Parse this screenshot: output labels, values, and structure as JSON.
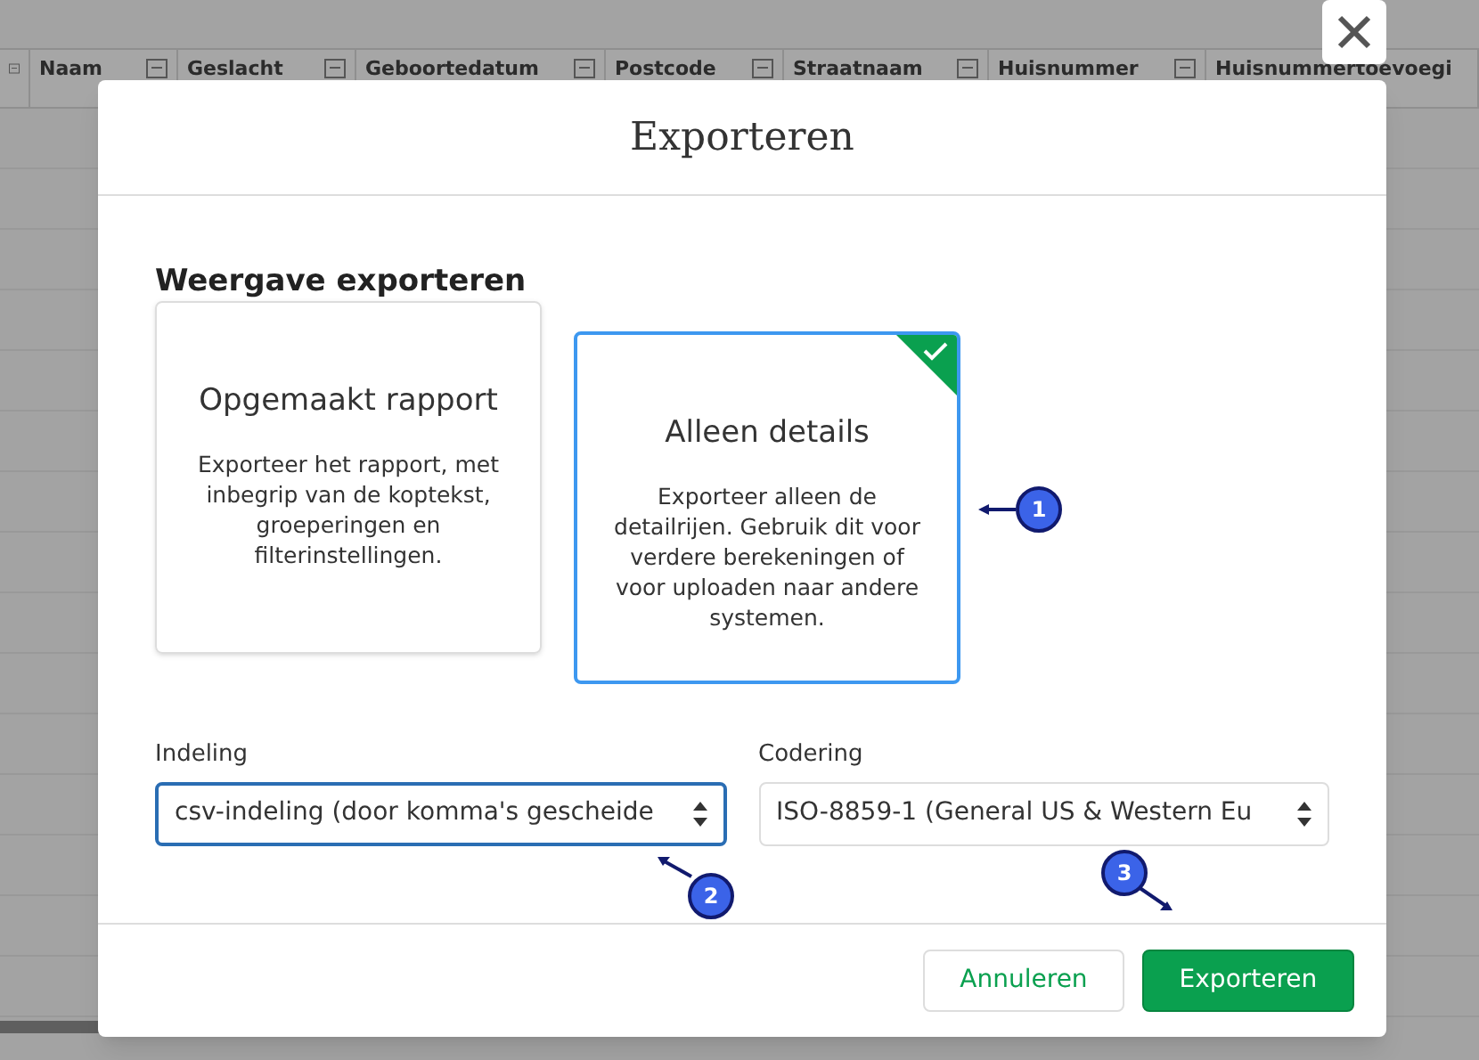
{
  "background_table": {
    "columns": [
      "Naam",
      "Geslacht",
      "Geboortedatum",
      "Postcode",
      "Straatnaam",
      "Huisnummer",
      "Huisnummertoevoegi"
    ]
  },
  "dialog": {
    "title": "Exporteren",
    "section_title": "Weergave exporteren",
    "options": [
      {
        "title": "Opgemaakt rapport",
        "description": "Exporteer het rapport, met inbegrip van de koptekst, groeperingen en filterinstellingen.",
        "selected": false
      },
      {
        "title": "Alleen details",
        "description": "Exporteer alleen de detailrijen. Gebruik dit voor verdere berekeningen of voor uploaden naar andere systemen.",
        "selected": true
      }
    ],
    "fields": [
      {
        "label": "Indeling",
        "value": "csv-indeling (door komma's gescheide",
        "focused": true
      },
      {
        "label": "Codering",
        "value": "ISO-8859-1 (General US & Western Eu",
        "focused": false
      }
    ],
    "buttons": [
      {
        "label": "Annuleren",
        "kind": "secondary"
      },
      {
        "label": "Exporteren",
        "kind": "primary"
      }
    ]
  },
  "callouts": [
    {
      "number": "1",
      "kind": "left"
    },
    {
      "number": "2",
      "kind": "up-left"
    },
    {
      "number": "3",
      "kind": "down-right"
    }
  ]
}
